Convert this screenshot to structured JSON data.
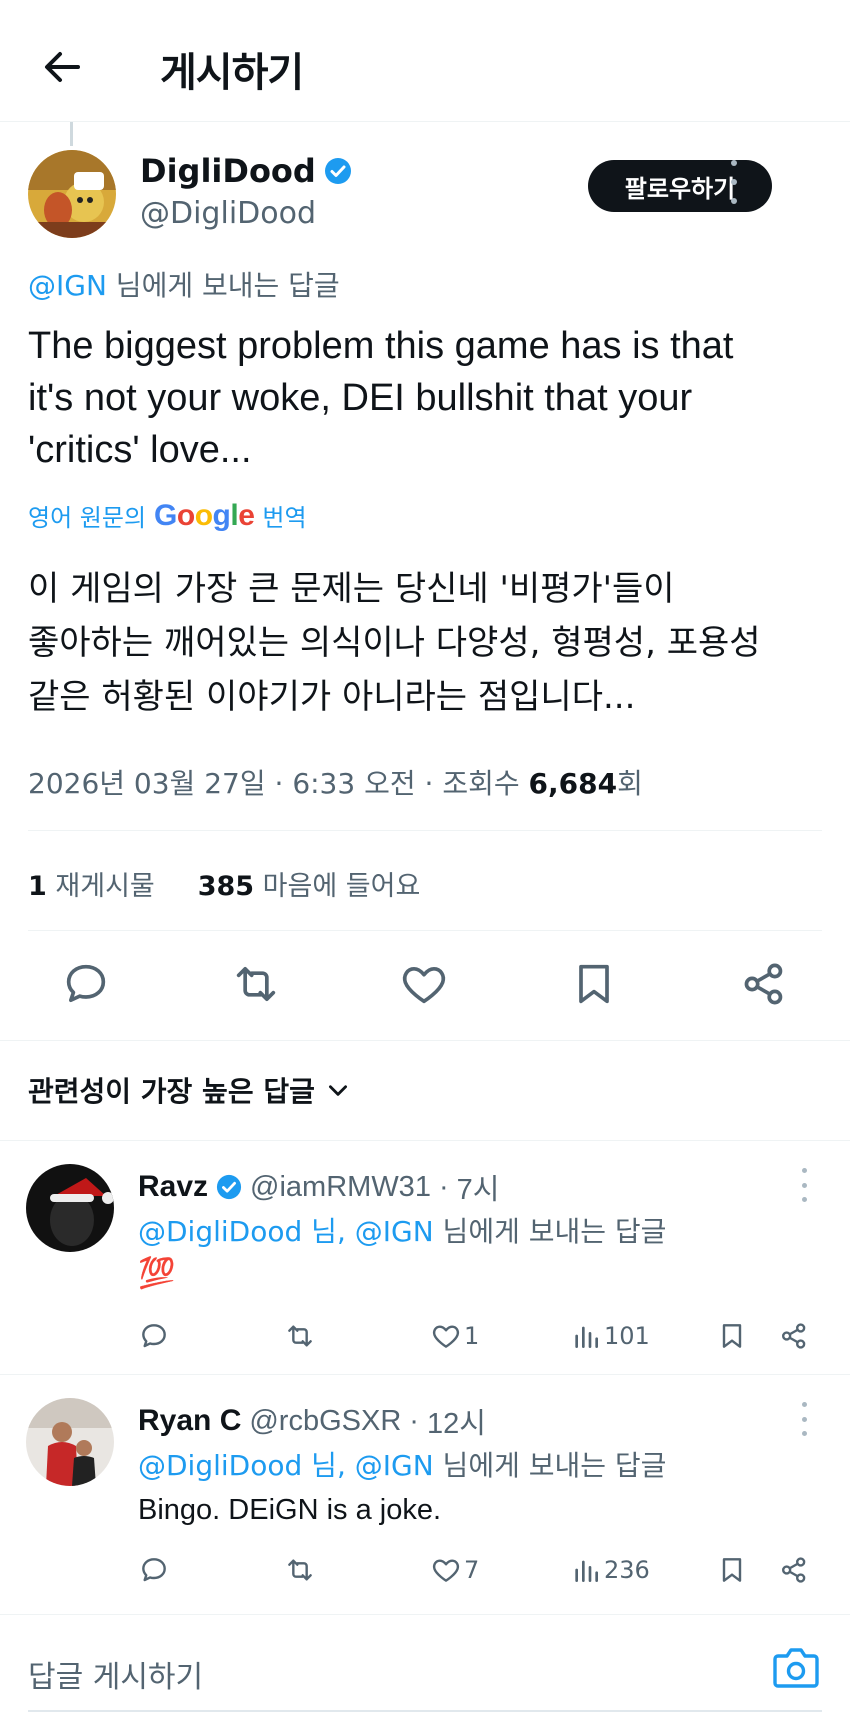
{
  "header": {
    "back_icon": "arrow-left-icon",
    "title": "게시하기"
  },
  "main_tweet": {
    "author_name": "DigliDood",
    "author_handle": "@DigliDood",
    "verified": true,
    "follow_label": "팔로우하기",
    "replying_prefix": "@IGN",
    "replying_suffix": " 님에게 보내는 답글",
    "text_lines": [
      "The biggest problem this game has is that",
      "it's not your woke, DEI bullshit that your",
      "'critics' love..."
    ],
    "translate_prefix": "영어 원문의",
    "translate_brand": "Google",
    "translate_suffix": "번역",
    "translated_lines": [
      "이 게임의 가장 큰 문제는 당신네 '비평가'들이",
      "좋아하는 깨어있는 의식이나 다양성, 형평성, 포용성",
      "같은 허황된 이야기가 아니라는 점입니다..."
    ],
    "date": "2026년 03월 27일",
    "time": "6:33 오전",
    "views_label": "조회수",
    "views_count": "6,684",
    "views_suffix": "회",
    "reposts_count": "1",
    "reposts_label": "재게시물",
    "likes_count": "385",
    "likes_label": "마음에 들어요"
  },
  "sort": {
    "label": "관련성이 가장 높은 답글"
  },
  "replies": [
    {
      "name": "Ravz",
      "verified": true,
      "handle": "@iamRMW31",
      "age": "7시",
      "reply_to_1": "@DigliDood",
      "reply_to_mid": " 님, ",
      "reply_to_2": "@IGN",
      "reply_to_suffix": " 님에게 보내는 답글",
      "body": "💯",
      "likes": "1",
      "views": "101"
    },
    {
      "name": "Ryan C",
      "verified": false,
      "handle": "@rcbGSXR",
      "age": "12시",
      "reply_to_1": "@DigliDood",
      "reply_to_mid": " 님, ",
      "reply_to_2": "@IGN",
      "reply_to_suffix": " 님에게 보내는 답글",
      "body": "Bingo. DEiGN is a joke.",
      "likes": "7",
      "views": "236"
    }
  ],
  "composer": {
    "placeholder": "답글 게시하기",
    "camera_icon": "camera-icon"
  },
  "colors": {
    "accent": "#1d9bf0",
    "text": "#0f1419",
    "secondary": "#536471",
    "divider": "#eff3f4"
  }
}
